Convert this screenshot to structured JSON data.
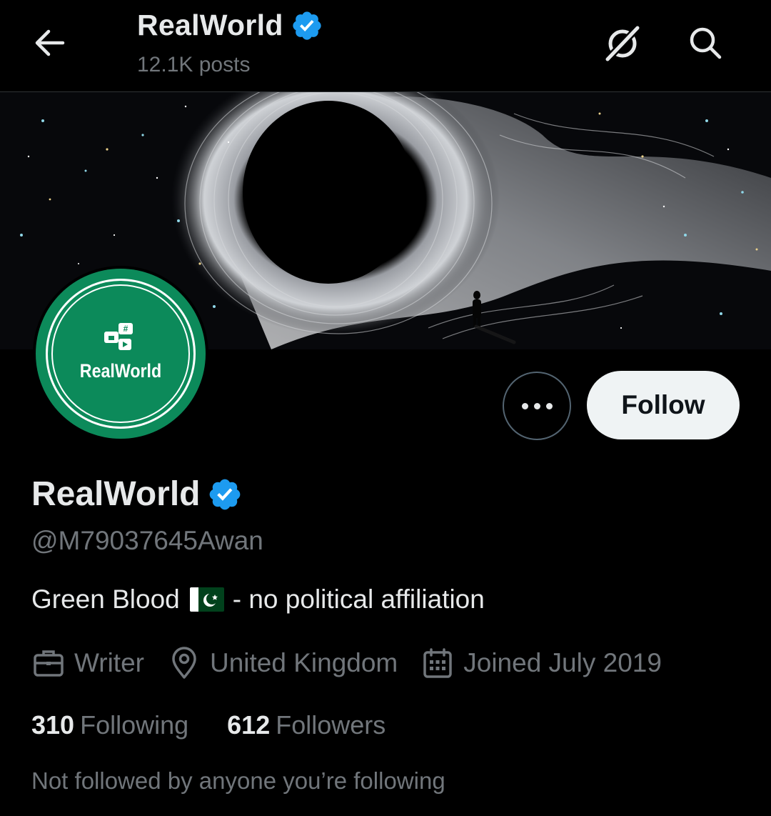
{
  "topbar": {
    "title": "RealWorld",
    "posts": "12.1K posts",
    "back_icon": "arrow-left-icon",
    "grok_icon": "grok-icon",
    "search_icon": "search-icon"
  },
  "banner": {
    "description_icon": "banner-image"
  },
  "avatar": {
    "logo_text": "RealWorld",
    "background_color": "#0c8a5a"
  },
  "actions": {
    "follow_label": "Follow",
    "more_icon": "more-options-icon"
  },
  "profile": {
    "display_name": "RealWorld",
    "verified": true,
    "verified_color": "#1d9bf0",
    "handle": "@M79037645Awan",
    "bio_prefix": "Green Blood",
    "bio_flag": "pakistan-flag-icon",
    "bio_suffix": "- no political affiliation"
  },
  "meta": {
    "profession": "Writer",
    "location": "United Kingdom",
    "joined": "Joined July 2019"
  },
  "stats": {
    "following_count": "310",
    "following_label": "Following",
    "followers_count": "612",
    "followers_label": "Followers"
  },
  "social_context": "Not followed by anyone you’re following",
  "colors": {
    "background": "#000000",
    "text_primary": "#e7e9ea",
    "text_secondary": "#71767b",
    "follow_button_bg": "#eff3f4"
  }
}
